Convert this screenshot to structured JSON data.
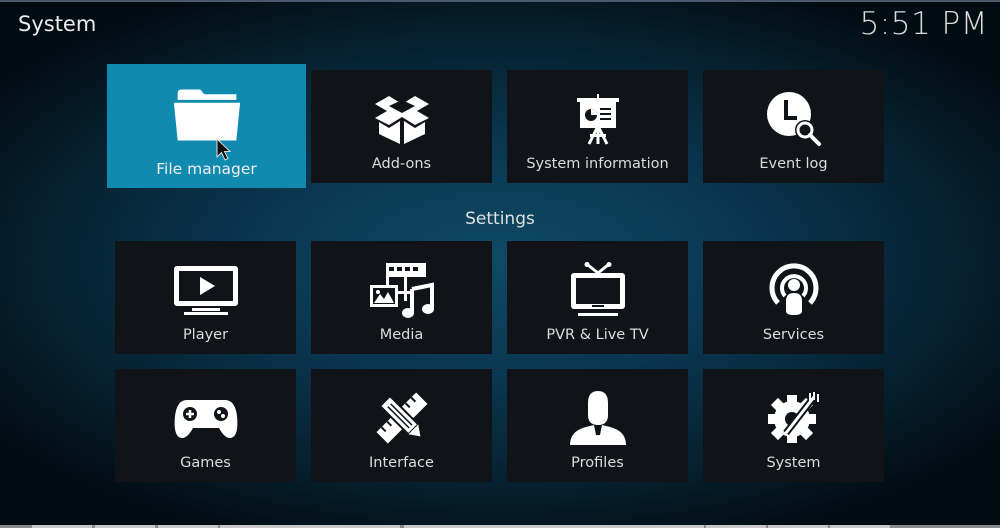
{
  "header": {
    "title": "System",
    "clock": "5:51 PM"
  },
  "top_row": [
    {
      "label": "File manager",
      "icon": "folder-icon",
      "focused": true
    },
    {
      "label": "Add-ons",
      "icon": "open-box-icon",
      "focused": false
    },
    {
      "label": "System information",
      "icon": "presentation-board-icon",
      "focused": false
    },
    {
      "label": "Event log",
      "icon": "clock-search-icon",
      "focused": false
    }
  ],
  "settings": {
    "heading": "Settings",
    "items": [
      {
        "label": "Player",
        "icon": "monitor-play-icon"
      },
      {
        "label": "Media",
        "icon": "media-film-music-icon"
      },
      {
        "label": "PVR & Live TV",
        "icon": "tv-antenna-icon"
      },
      {
        "label": "Services",
        "icon": "broadcast-user-icon"
      },
      {
        "label": "Games",
        "icon": "gamepad-icon"
      },
      {
        "label": "Interface",
        "icon": "pencil-ruler-icon"
      },
      {
        "label": "Profiles",
        "icon": "user-silhouette-icon"
      },
      {
        "label": "System",
        "icon": "gear-tools-icon"
      }
    ]
  },
  "colors": {
    "accent": "#118ab0",
    "tile": "#101418",
    "background": "#0a3650"
  }
}
